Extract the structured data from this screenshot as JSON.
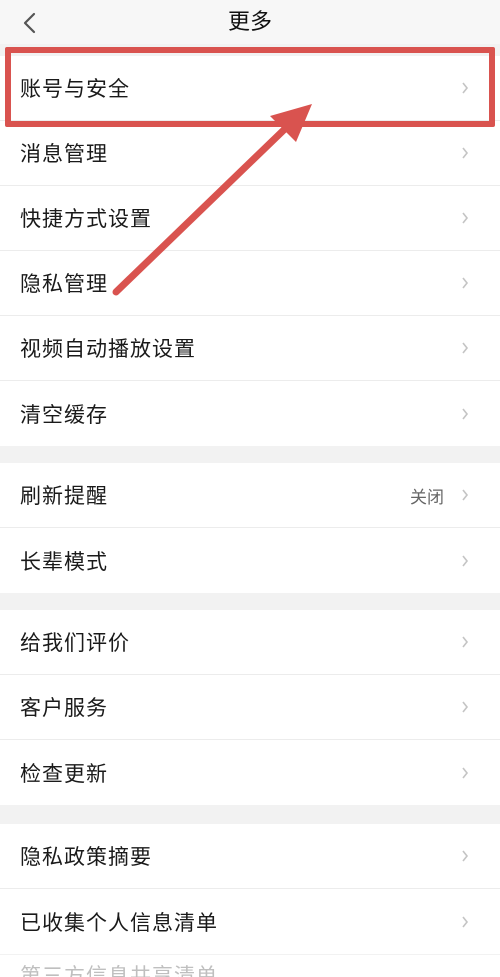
{
  "header": {
    "title": "更多",
    "back_icon": "chevron-left-icon"
  },
  "groups": [
    {
      "items": [
        {
          "label": "账号与安全"
        },
        {
          "label": "消息管理"
        },
        {
          "label": "快捷方式设置"
        },
        {
          "label": "隐私管理"
        },
        {
          "label": "视频自动播放设置"
        },
        {
          "label": "清空缓存"
        }
      ]
    },
    {
      "items": [
        {
          "label": "刷新提醒",
          "value": "关闭"
        },
        {
          "label": "长辈模式"
        }
      ]
    },
    {
      "items": [
        {
          "label": "给我们评价"
        },
        {
          "label": "客户服务"
        },
        {
          "label": "检查更新"
        }
      ]
    },
    {
      "items": [
        {
          "label": "隐私政策摘要"
        },
        {
          "label": "已收集个人信息清单"
        }
      ]
    }
  ],
  "partial_row": {
    "label": "第三方信息共享清单"
  },
  "annotation": {
    "highlight_color": "#d9534f"
  }
}
